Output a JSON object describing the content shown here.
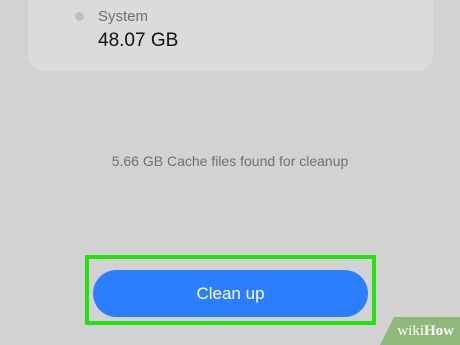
{
  "storage_card": {
    "category_label": "System",
    "category_size": "48.07 GB"
  },
  "cache_message": "5.66 GB Cache files found for cleanup",
  "cleanup_button": {
    "label": "Clean up",
    "color": "#2b7fff",
    "highlight_color": "#26e010"
  },
  "watermark": {
    "wiki": "wiki",
    "how": "How"
  }
}
